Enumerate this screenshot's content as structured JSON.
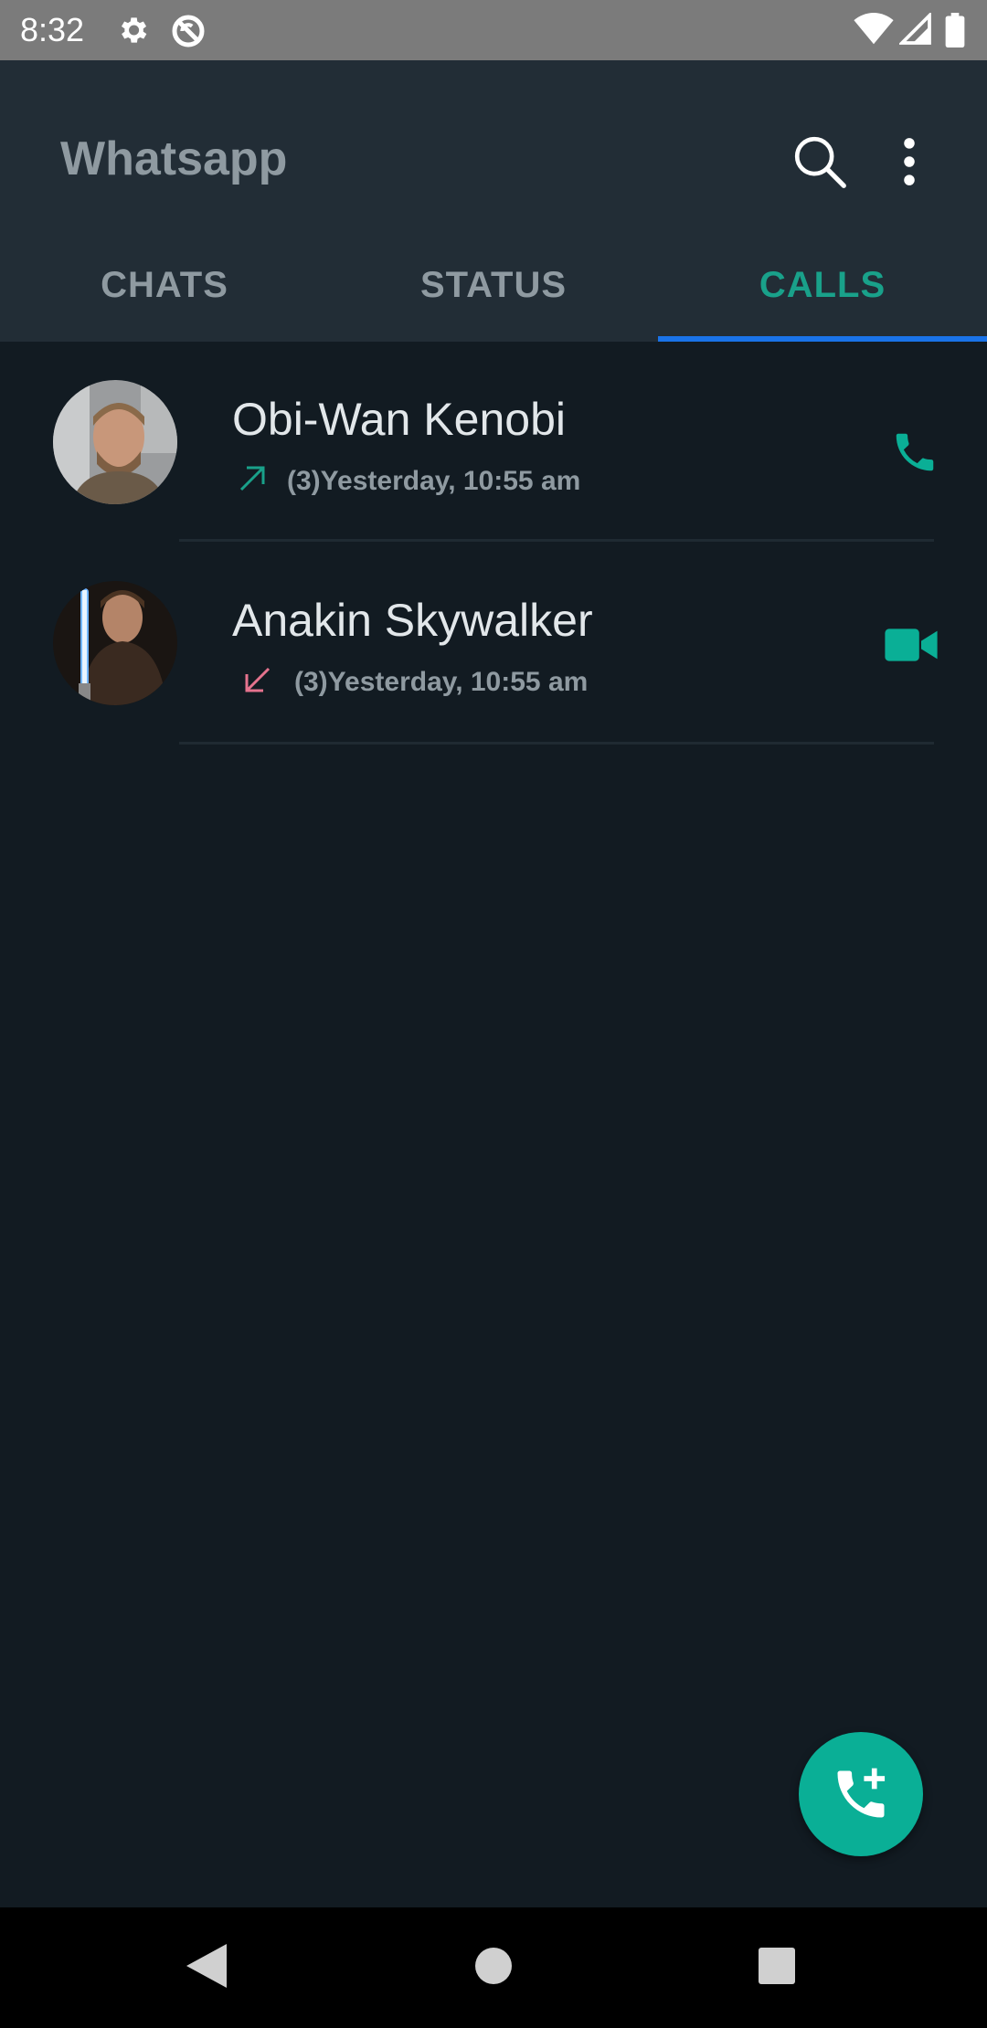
{
  "status_bar": {
    "time": "8:32"
  },
  "app_bar": {
    "title": "Whatsapp"
  },
  "tabs": [
    {
      "label": "CHATS",
      "active": false
    },
    {
      "label": "STATUS",
      "active": false
    },
    {
      "label": "CALLS",
      "active": true
    }
  ],
  "calls": [
    {
      "name": "Obi-Wan Kenobi",
      "meta": "(3)Yesterday, 10:55 am",
      "direction": "outgoing",
      "direction_icon": "outgoing-arrow-icon",
      "call_type": "voice",
      "action_icon": "phone-icon"
    },
    {
      "name": "Anakin Skywalker",
      "meta": "(3)Yesterday, 10:55 am",
      "direction": "missed",
      "direction_icon": "missed-arrow-icon",
      "call_type": "video",
      "action_icon": "video-camera-icon"
    }
  ],
  "fab": {
    "icon": "add-call-icon"
  },
  "colors": {
    "background": "#121b22",
    "appbar": "#222d36",
    "accent": "#0aaf96",
    "tab_indicator": "#1a73e8",
    "missed": "#e5738e"
  }
}
